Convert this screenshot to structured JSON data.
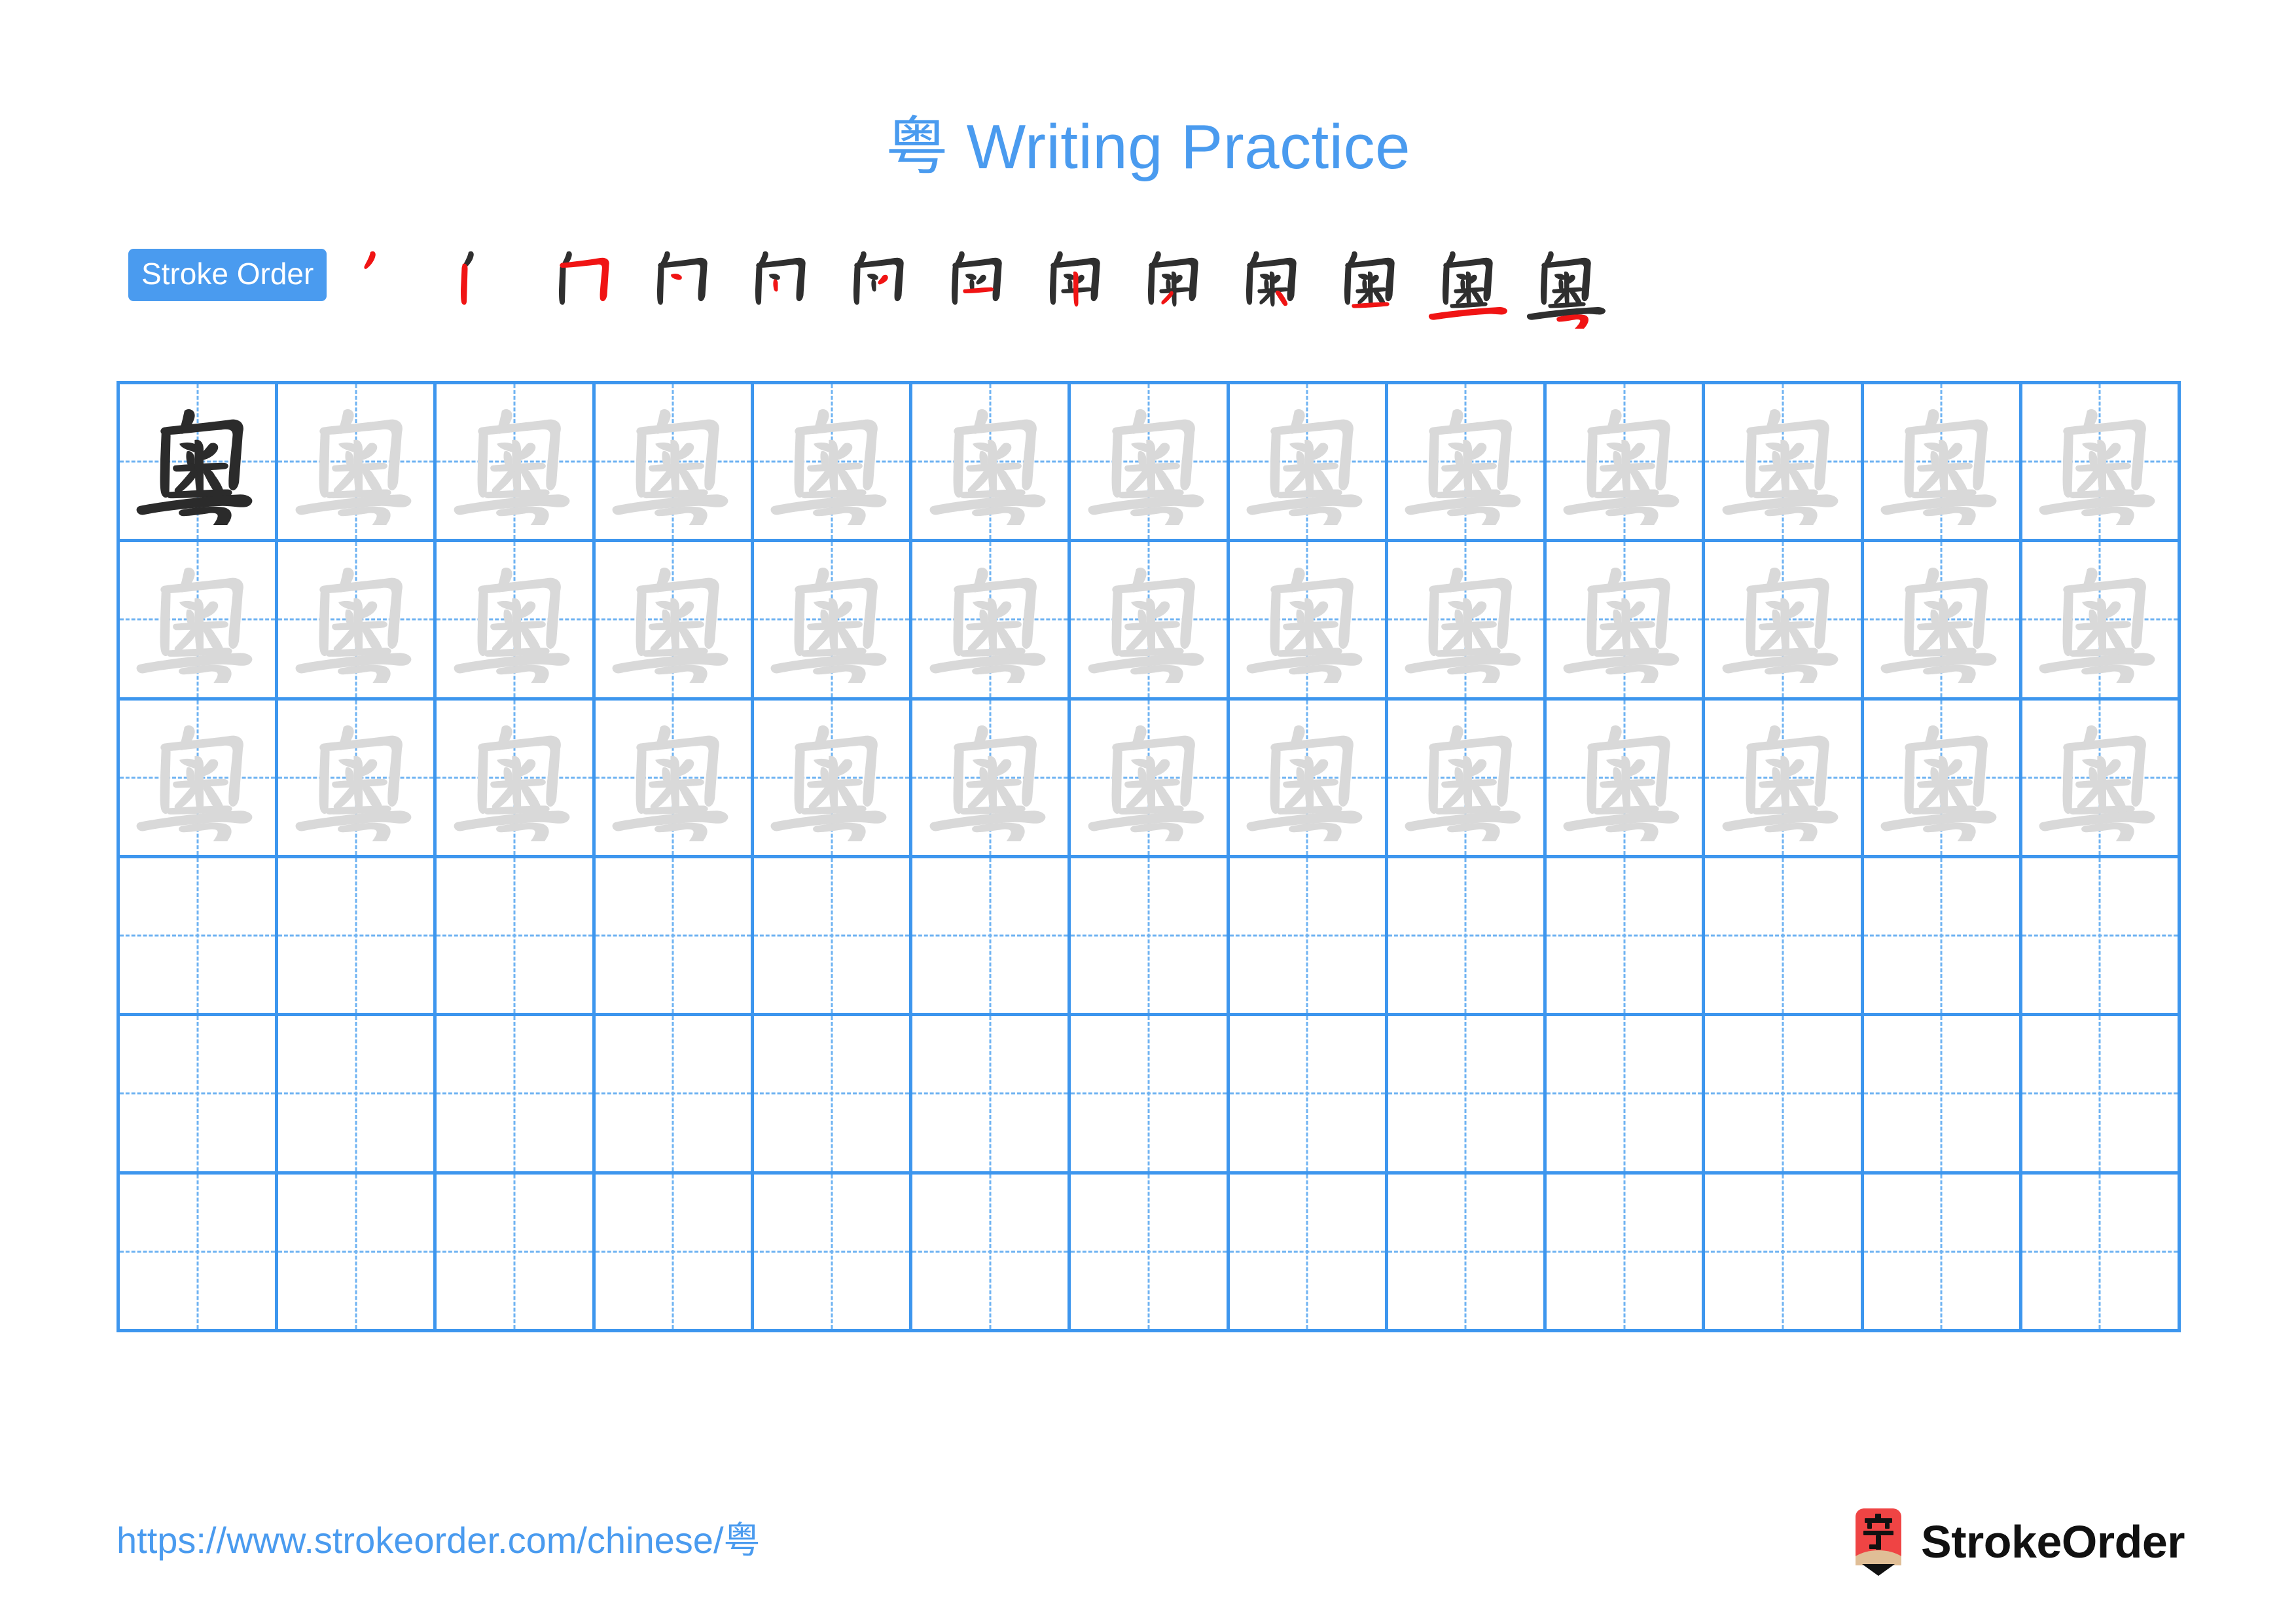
{
  "character": "粤",
  "page": {
    "title": "粤 Writing Practice",
    "background_color": "#ffffff"
  },
  "colors": {
    "accent_blue": "#4A9BEF",
    "grid_line_blue": "#3D96EE",
    "grid_dash_blue": "#6FB3F2",
    "stroke_new_red": "#F01414",
    "stroke_done_dark": "#2F2F2F",
    "trace_gray": "#D9D9D9",
    "logo_red": "#EF4444",
    "logo_wood": "#E0BE96",
    "logo_tip_black": "#111111"
  },
  "stroke_order": {
    "badge_label": "Stroke Order",
    "total_strokes": 13,
    "steps": [
      {
        "index": 1,
        "new_stroke_label": "dian-dot"
      },
      {
        "index": 2,
        "new_stroke_label": "shu-vertical"
      },
      {
        "index": 3,
        "new_stroke_label": "heng-zhe-gou"
      },
      {
        "index": 4,
        "new_stroke_label": "pie-short"
      },
      {
        "index": 5,
        "new_stroke_label": "dian-inner"
      },
      {
        "index": 6,
        "new_stroke_label": "pie-inner"
      },
      {
        "index": 7,
        "new_stroke_label": "heng-inner"
      },
      {
        "index": 8,
        "new_stroke_label": "shu-inner"
      },
      {
        "index": 9,
        "new_stroke_label": "pie-cross"
      },
      {
        "index": 10,
        "new_stroke_label": "na-cross"
      },
      {
        "index": 11,
        "new_stroke_label": "heng-bottom-box"
      },
      {
        "index": 12,
        "new_stroke_label": "heng-long"
      },
      {
        "index": 13,
        "new_stroke_label": "heng-zhe-wan-gou"
      }
    ]
  },
  "practice_grid": {
    "rows": 6,
    "columns": 13,
    "guide_style": "dashed-crosshair",
    "row_fill": [
      {
        "row": 1,
        "cells": [
          "dark",
          "trace",
          "trace",
          "trace",
          "trace",
          "trace",
          "trace",
          "trace",
          "trace",
          "trace",
          "trace",
          "trace",
          "trace"
        ]
      },
      {
        "row": 2,
        "cells": [
          "trace",
          "trace",
          "trace",
          "trace",
          "trace",
          "trace",
          "trace",
          "trace",
          "trace",
          "trace",
          "trace",
          "trace",
          "trace"
        ]
      },
      {
        "row": 3,
        "cells": [
          "trace",
          "trace",
          "trace",
          "trace",
          "trace",
          "trace",
          "trace",
          "trace",
          "trace",
          "trace",
          "trace",
          "trace",
          "trace"
        ]
      },
      {
        "row": 4,
        "cells": [
          "empty",
          "empty",
          "empty",
          "empty",
          "empty",
          "empty",
          "empty",
          "empty",
          "empty",
          "empty",
          "empty",
          "empty",
          "empty"
        ]
      },
      {
        "row": 5,
        "cells": [
          "empty",
          "empty",
          "empty",
          "empty",
          "empty",
          "empty",
          "empty",
          "empty",
          "empty",
          "empty",
          "empty",
          "empty",
          "empty"
        ]
      },
      {
        "row": 6,
        "cells": [
          "empty",
          "empty",
          "empty",
          "empty",
          "empty",
          "empty",
          "empty",
          "empty",
          "empty",
          "empty",
          "empty",
          "empty",
          "empty"
        ]
      }
    ]
  },
  "footer": {
    "url": "https://www.strokeorder.com/chinese/粤",
    "brand_name": "StrokeOrder",
    "logo_character": "字"
  }
}
